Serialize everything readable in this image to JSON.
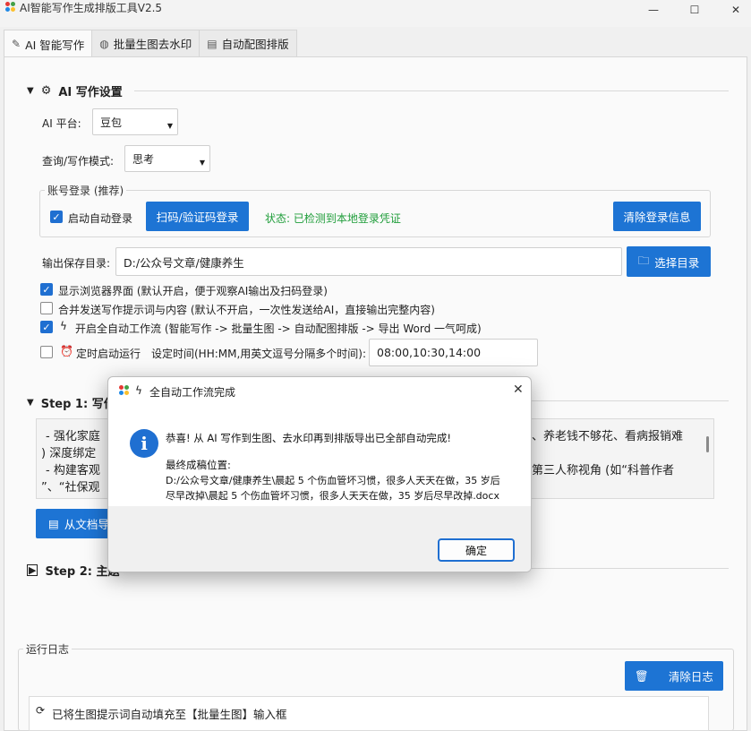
{
  "window": {
    "title": "AI智能写作生成排版工具V2.5",
    "minimize": "—",
    "maximize": "☐",
    "close": "✕"
  },
  "tabs": [
    {
      "label": "AI 智能写作",
      "icon": "pen-icon"
    },
    {
      "label": "批量生图去水印",
      "icon": "palette-icon"
    },
    {
      "label": "自动配图排版",
      "icon": "document-icon"
    }
  ],
  "settings": {
    "header": "AI 写作设置",
    "platform_label": "AI 平台:",
    "platform_value": "豆包",
    "mode_label": "查询/写作模式:",
    "mode_value": "思考",
    "login_group_title": "账号登录 (推荐)",
    "auto_login_label": "启动自动登录",
    "scan_login_button": "扫码/验证码登录",
    "status_text": "状态: 已检测到本地登录凭证",
    "clear_login_button": "清除登录信息",
    "output_label": "输出保存目录:",
    "output_value": "D:/公众号文章/健康养生",
    "choose_dir_button": "选择目录",
    "opt_show_browser": "显示浏览器界面 (默认开启，便于观察AI输出及扫码登录)",
    "opt_merge_send": "合并发送写作提示词与内容 (默认不开启，一次性发送给AI，直接输出完整内容)",
    "opt_workflow": "开启全自动工作流 (智能写作 -> 批量生图 -> 自动配图排版 -> 导出 Word 一气呵成)",
    "opt_schedule": "定时启动运行",
    "schedule_time_label": "设定时间(HH:MM,用英文逗号分隔多个时间):",
    "schedule_time_value": "08:00,10:30,14:00"
  },
  "step1": {
    "header": "Step 1: 写作",
    "line1_left": "- 强化家庭",
    "line1_right": "、养老钱不够花、看病报销难",
    "line2": ") 深度绑定",
    "line3_left": "- 构建客观",
    "line3_right": "第三人称视角 (如“科普作者",
    "line4": "”、“社保观",
    "import_button": "从文档导"
  },
  "step2": {
    "header": "Step 2: 主题"
  },
  "log": {
    "title": "运行日志",
    "clear_button": "清除日志",
    "entry": "已将生图提示词自动填充至【批量生图】输入框"
  },
  "dialog": {
    "title": "全自动工作流完成",
    "message": "恭喜! 从 AI 写作到生图、去水印再到排版导出已全部自动完成!",
    "path_label": "最终成稿位置:",
    "path_line1": "D:/公众号文章/健康养生\\晨起 5 个伤血管坏习惯，很多人天天在做，35 岁后",
    "path_line2": "尽早改掉\\晨起 5 个伤血管坏习惯，很多人天天在做，35 岁后尽早改掉.docx",
    "ok_button": "确定"
  },
  "colors": {
    "accent": "#1d74d4",
    "status_green": "#1f9d3a"
  }
}
